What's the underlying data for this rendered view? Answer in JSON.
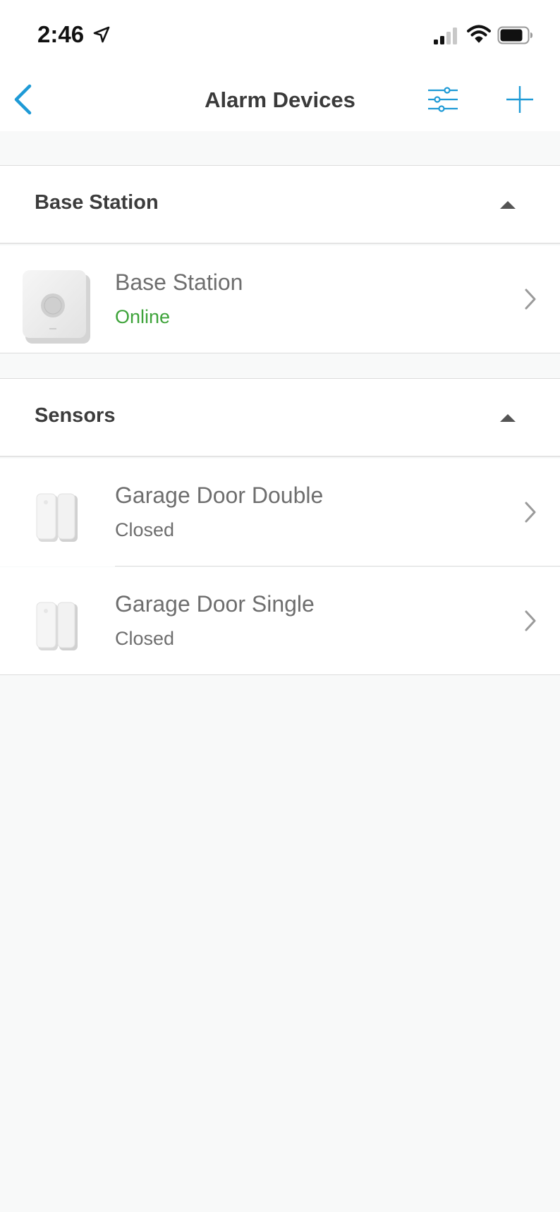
{
  "status_bar": {
    "time": "2:46"
  },
  "nav": {
    "title": "Alarm Devices"
  },
  "sections": [
    {
      "title": "Base Station",
      "devices": [
        {
          "name": "Base Station",
          "status": "Online"
        }
      ]
    },
    {
      "title": "Sensors",
      "devices": [
        {
          "name": "Garage Door Double",
          "status": "Closed"
        },
        {
          "name": "Garage Door Single",
          "status": "Closed"
        }
      ]
    }
  ],
  "colors": {
    "accent": "#1e9ad6",
    "online": "#3ea33a",
    "text_primary": "#3a3a3a",
    "text_secondary": "#6e6e6e",
    "background": "#f8f9f9"
  },
  "icons": [
    "location-arrow-icon",
    "signal-icon",
    "wifi-icon",
    "battery-icon",
    "back-chevron-icon",
    "filter-sliders-icon",
    "plus-icon",
    "collapse-triangle-icon",
    "chevron-right-icon",
    "base-station-device-icon",
    "contact-sensor-device-icon"
  ]
}
